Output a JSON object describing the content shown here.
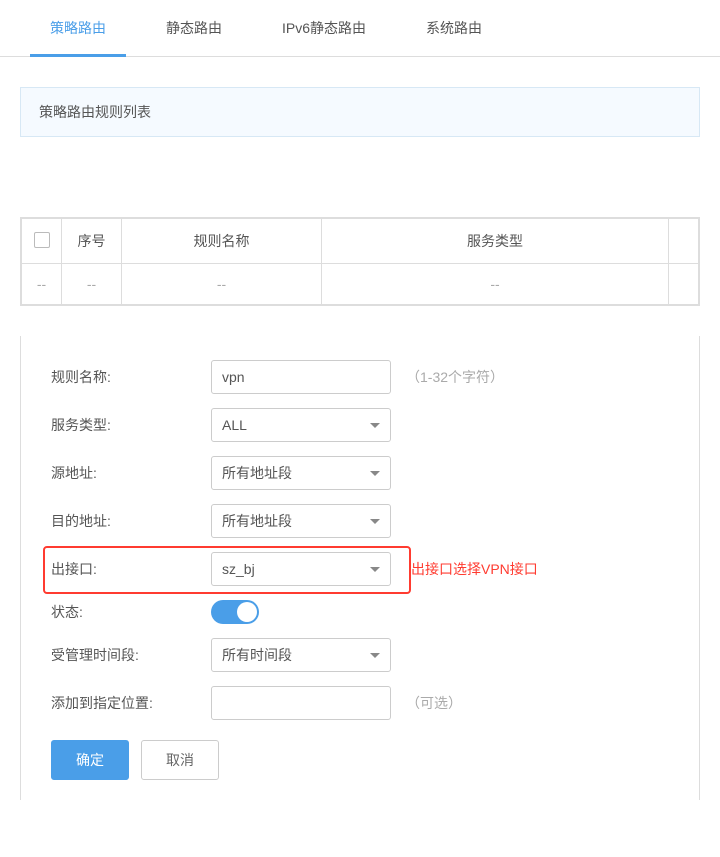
{
  "tabs": {
    "items": [
      {
        "label": "策略路由",
        "active": true
      },
      {
        "label": "静态路由",
        "active": false
      },
      {
        "label": "IPv6静态路由",
        "active": false
      },
      {
        "label": "系统路由",
        "active": false
      }
    ]
  },
  "section_title": "策略路由规则列表",
  "table": {
    "headers": {
      "index": "序号",
      "name": "规则名称",
      "service": "服务类型"
    },
    "placeholder_row": {
      "chk": "--",
      "index": "--",
      "name": "--",
      "service": "--"
    }
  },
  "form": {
    "rule_name": {
      "label": "规则名称:",
      "value": "vpn",
      "hint": "（1-32个字符）"
    },
    "service_type": {
      "label": "服务类型:",
      "value": "ALL"
    },
    "src_addr": {
      "label": "源地址:",
      "value": "所有地址段"
    },
    "dst_addr": {
      "label": "目的地址:",
      "value": "所有地址段"
    },
    "out_if": {
      "label": "出接口:",
      "value": "sz_bj",
      "annotation": "出接口选择VPN接口"
    },
    "status": {
      "label": "状态:",
      "on": true
    },
    "time_range": {
      "label": "受管理时间段:",
      "value": "所有时间段"
    },
    "insert_pos": {
      "label": "添加到指定位置:",
      "value": "",
      "hint": "（可选）"
    }
  },
  "buttons": {
    "ok": "确定",
    "cancel": "取消"
  }
}
